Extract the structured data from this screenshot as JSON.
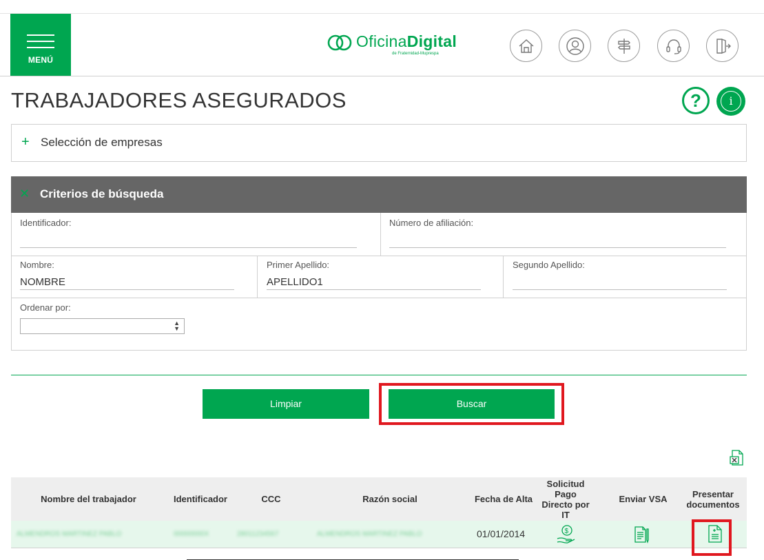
{
  "header": {
    "menu_label": "MENÚ",
    "brand_prefix": "Oficina",
    "brand_suffix": "Digital",
    "brand_sub": "de Fraternidad-Muprespa",
    "icons": [
      "home-icon",
      "user-icon",
      "signpost-icon",
      "headset-icon",
      "logout-icon"
    ]
  },
  "page": {
    "title": "TRABAJADORES ASEGURADOS",
    "help": "?",
    "info": "i"
  },
  "empresas": {
    "label": "Selección de empresas"
  },
  "criteria": {
    "title": "Criterios de búsqueda",
    "identificador_label": "Identificador:",
    "identificador_value": "",
    "afiliacion_label": "Número de afiliación:",
    "afiliacion_value": "",
    "nombre_label": "Nombre:",
    "nombre_value": "NOMBRE",
    "apellido1_label": "Primer Apellido:",
    "apellido1_value": "APELLIDO1",
    "apellido2_label": "Segundo Apellido:",
    "apellido2_value": "",
    "ordenar_label": "Ordenar por:",
    "ordenar_value": ""
  },
  "actions": {
    "limpiar": "Limpiar",
    "buscar": "Buscar"
  },
  "table": {
    "headers": {
      "nombre": "Nombre del trabajador",
      "identificador": "Identificador",
      "ccc": "CCC",
      "razon": "Razón social",
      "fecha": "Fecha de Alta",
      "solicitud": "Solicitud Pago Directo por IT",
      "vsa": "Enviar VSA",
      "presentar": "Presentar documentos"
    },
    "rows": [
      {
        "nombre": "ALMENDROS MARTINEZ PABLO",
        "identificador": "00000000X",
        "ccc": "28011234567",
        "razon": "ALMENDROS MARTINEZ PABLO",
        "fecha": "01/01/2014"
      }
    ]
  },
  "colors": {
    "brand_green": "#00a650",
    "header_gray": "#666666",
    "highlight_red": "#e0181f"
  }
}
